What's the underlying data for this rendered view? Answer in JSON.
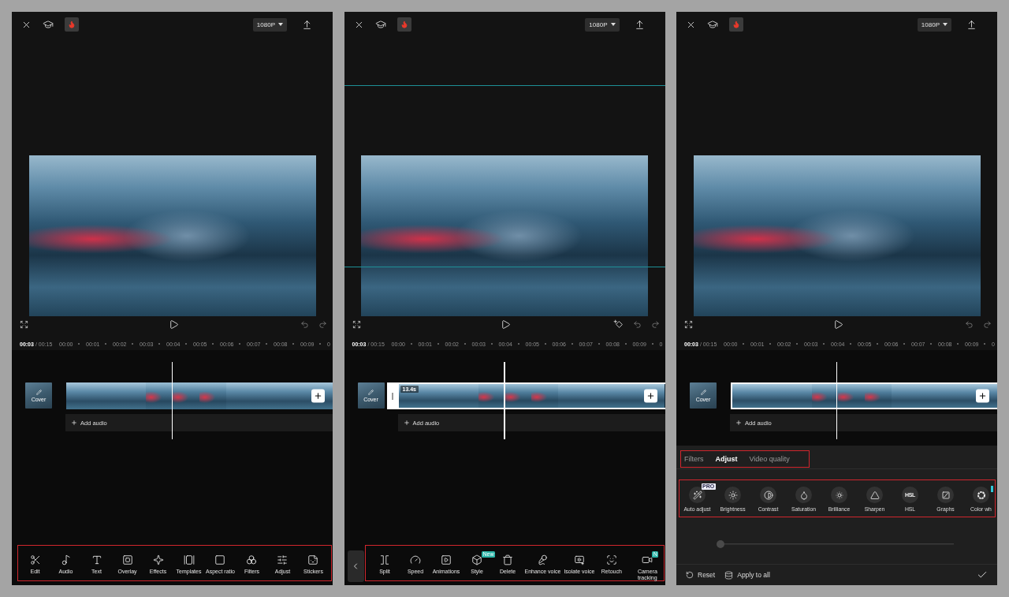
{
  "panels": [
    {
      "top_bar": {
        "resolution": "1080P"
      },
      "preview": {
        "guides": false,
        "keyframe_button": false
      },
      "timeline": {
        "current_time": "00:03",
        "total_time": "/ 00:15",
        "ticks": [
          "00:00",
          "00:01",
          "00:02",
          "00:03",
          "00:04",
          "00:05",
          "00:06",
          "00:07",
          "00:08",
          "00:09",
          "0"
        ],
        "cover": "Cover",
        "clip": {
          "selected": false,
          "trim_handles": false
        },
        "add_audio": "Add audio"
      },
      "toolbar": {
        "highlighted": true,
        "back_button": false,
        "items": [
          {
            "label": "Edit"
          },
          {
            "label": "Audio"
          },
          {
            "label": "Text"
          },
          {
            "label": "Overlay"
          },
          {
            "label": "Effects"
          },
          {
            "label": "Templates"
          },
          {
            "label": "Aspect ratio"
          },
          {
            "label": "Filters"
          },
          {
            "label": "Adjust"
          },
          {
            "label": "Stickers"
          }
        ]
      }
    },
    {
      "top_bar": {
        "resolution": "1080P"
      },
      "preview": {
        "guides": true,
        "keyframe_button": true
      },
      "timeline": {
        "current_time": "00:03",
        "total_time": "/ 00:15",
        "ticks": [
          "00:00",
          "00:01",
          "00:02",
          "00:03",
          "00:04",
          "00:05",
          "00:06",
          "00:07",
          "00:08",
          "00:09",
          "0"
        ],
        "cover": "Cover",
        "clip": {
          "selected": true,
          "trim_handles": true,
          "duration": "13.4s"
        },
        "add_audio": "Add audio"
      },
      "toolbar": {
        "highlighted": true,
        "back_button": true,
        "items": [
          {
            "label": "Split"
          },
          {
            "label": "Speed"
          },
          {
            "label": "Animations"
          },
          {
            "label": "Style",
            "badge": "New"
          },
          {
            "label": "Delete"
          },
          {
            "label": "Enhance voice"
          },
          {
            "label": "Isolate voice"
          },
          {
            "label": "Retouch"
          },
          {
            "label": "Camera tracking",
            "badge": "N"
          }
        ]
      }
    },
    {
      "top_bar": {
        "resolution": "1080P"
      },
      "preview": {
        "guides": false,
        "keyframe_button": false
      },
      "timeline": {
        "current_time": "00:03",
        "total_time": "/ 00:15",
        "ticks": [
          "00:00",
          "00:01",
          "00:02",
          "00:03",
          "00:04",
          "00:05",
          "00:06",
          "00:07",
          "00:08",
          "00:09",
          "0"
        ],
        "cover": "Cover",
        "clip": {
          "selected": true,
          "trim_handles": false
        },
        "add_audio": "Add audio"
      },
      "adjust_panel": {
        "tabs_highlighted": true,
        "tabs": [
          {
            "label": "Filters",
            "selected": false
          },
          {
            "label": "Adjust",
            "selected": true
          },
          {
            "label": "Video quality",
            "selected": false
          }
        ],
        "tools_highlighted": true,
        "tools": [
          {
            "kind": "icon",
            "label": "Auto adjust",
            "badge": "PRO"
          },
          {
            "kind": "icon",
            "label": "Brightness"
          },
          {
            "kind": "icon",
            "label": "Contrast"
          },
          {
            "kind": "icon",
            "label": "Saturation"
          },
          {
            "kind": "icon",
            "label": "Brilliance"
          },
          {
            "kind": "icon",
            "label": "Sharpen"
          },
          {
            "kind": "glyph",
            "glyph": "HSL",
            "label": "HSL"
          },
          {
            "kind": "icon",
            "label": "Graphs"
          },
          {
            "kind": "icon",
            "label": "Color wh",
            "tag": true
          }
        ],
        "slider": {
          "level": 0
        },
        "reset": "Reset",
        "apply_all": "Apply to all"
      }
    }
  ]
}
